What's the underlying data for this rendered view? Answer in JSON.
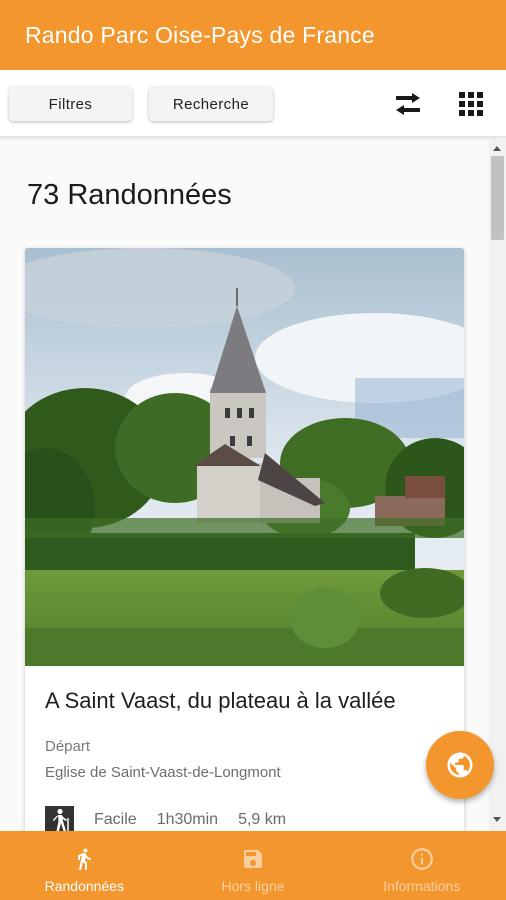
{
  "app": {
    "title": "Rando Parc Oise-Pays de France"
  },
  "toolbar": {
    "filters_label": "Filtres",
    "search_label": "Recherche",
    "swap_icon": "swap-horizontal-icon",
    "grid_icon": "grid-view-icon"
  },
  "results": {
    "count_label": "73 Randonnées"
  },
  "hikes": [
    {
      "title": "A Saint Vaast, du plateau à la vallée",
      "depart_label": "Départ",
      "depart_value": "Eglise de Saint-Vaast-de-Longmont",
      "difficulty_icon": "hiker-icon",
      "difficulty": "Facile",
      "duration": "1h30min",
      "distance": "5,9 km"
    }
  ],
  "fab": {
    "icon": "globe-icon"
  },
  "bottom_nav": [
    {
      "label": "Randonnées",
      "icon": "walk-icon",
      "active": true
    },
    {
      "label": "Hors ligne",
      "icon": "save-icon",
      "active": false
    },
    {
      "label": "Informations",
      "icon": "info-icon",
      "active": false
    }
  ],
  "colors": {
    "primary": "#f3962d",
    "white": "#ffffff"
  }
}
